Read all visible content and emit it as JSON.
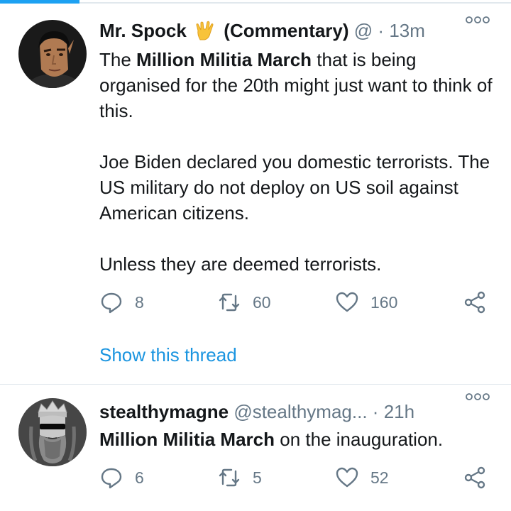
{
  "colors": {
    "accent": "#1da1f2",
    "link": "#1b95e0",
    "muted": "#657786",
    "text": "#14171a"
  },
  "tweets": [
    {
      "name": "Mr. Spock",
      "emoji": "vulcan-salute-emoji",
      "name_suffix": "(Commentary)",
      "handle": "@",
      "dot": "·",
      "time": "13m",
      "body": {
        "p1_bold": "Million Militia March",
        "p1_pre": "The ",
        "p1_post": " that is being organised for the 20th might just want to think of this.",
        "p2": "Joe Biden declared you domestic terrorists. The US military do not deploy on US soil against American citizens.",
        "p3": "Unless they are deemed terrorists."
      },
      "replies": "8",
      "retweets": "60",
      "likes": "160",
      "show_thread": "Show this thread"
    },
    {
      "name": "stealthymagne",
      "handle": "@stealthymag...",
      "dot": "·",
      "time": "21h",
      "body": {
        "bold": "Million Militia March",
        "post": " on the inauguration."
      },
      "replies": "6",
      "retweets": "5",
      "likes": "52"
    }
  ]
}
